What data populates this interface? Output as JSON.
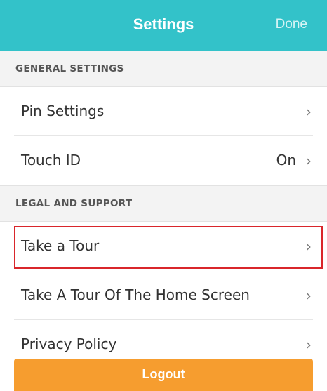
{
  "navbar": {
    "title": "Settings",
    "done_label": "Done"
  },
  "sections": {
    "general": "GENERAL SETTINGS",
    "legal": "LEGAL AND SUPPORT"
  },
  "rows": {
    "pin_settings": {
      "label": "Pin Settings",
      "chevron": "›"
    },
    "touch_id": {
      "label": "Touch ID",
      "value": "On",
      "chevron": "›"
    },
    "take_tour": {
      "label": "Take a Tour",
      "chevron": "›"
    },
    "tour_home": {
      "label": "Take A Tour Of The Home Screen",
      "chevron": "›"
    },
    "privacy": {
      "label": "Privacy Policy",
      "chevron": "›"
    }
  },
  "logout": {
    "label": "Logout"
  },
  "colors": {
    "navbar": "#33c2c9",
    "logout": "#f69d2f",
    "highlight": "#d9262b",
    "section_bg": "#f3f3f3"
  },
  "icons": {
    "chevron": "chevron-right-icon"
  }
}
